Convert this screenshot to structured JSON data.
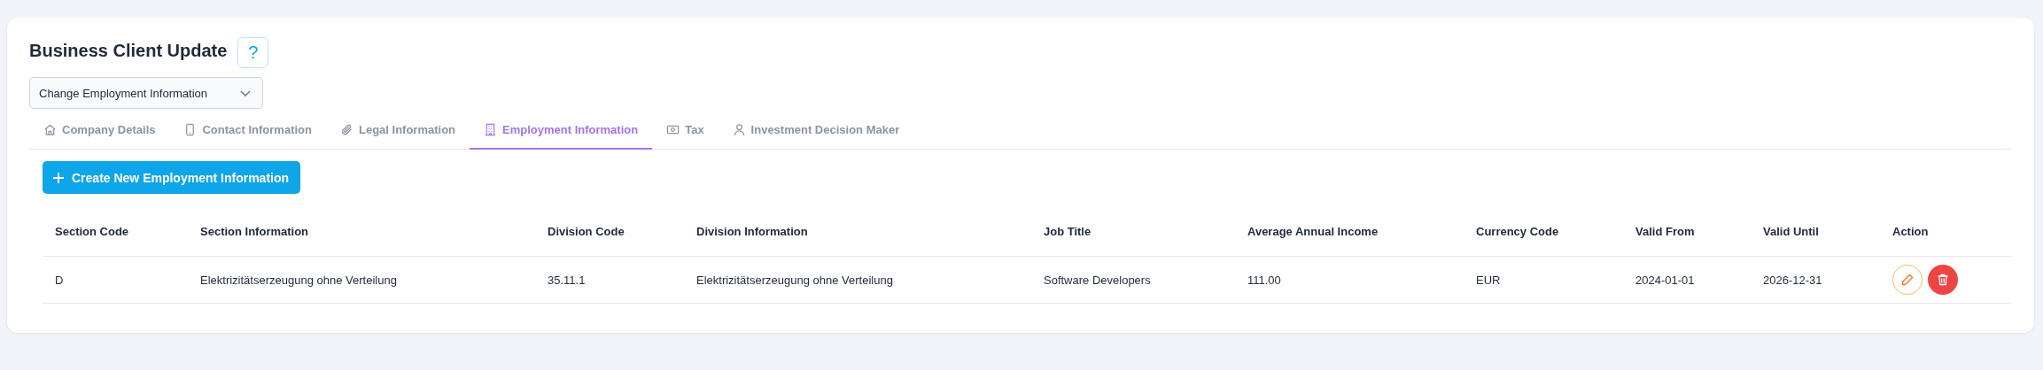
{
  "page": {
    "title": "Business Client Update",
    "help_label": "?"
  },
  "action_select": {
    "value": "Change Employment Information"
  },
  "tabs": [
    {
      "label": "Company Details",
      "selected": false
    },
    {
      "label": "Contact Information",
      "selected": false
    },
    {
      "label": "Legal Information",
      "selected": false
    },
    {
      "label": "Employment Information",
      "selected": true
    },
    {
      "label": "Tax",
      "selected": false
    },
    {
      "label": "Investment Decision Maker",
      "selected": false
    }
  ],
  "create_button": {
    "label": "Create New Employment Information"
  },
  "table": {
    "columns": [
      "Section Code",
      "Section Information",
      "Division Code",
      "Division Information",
      "Job Title",
      "Average Annual Income",
      "Currency Code",
      "Valid From",
      "Valid Until",
      "Action"
    ],
    "rows": [
      {
        "cells": [
          "D",
          "Elektrizitätserzeugung ohne Verteilung",
          "35.11.1",
          "Elektrizitätserzeugung ohne Verteilung",
          "Software Developers",
          "111.00",
          "EUR",
          "2024-01-01",
          "2026-12-31"
        ]
      }
    ]
  }
}
